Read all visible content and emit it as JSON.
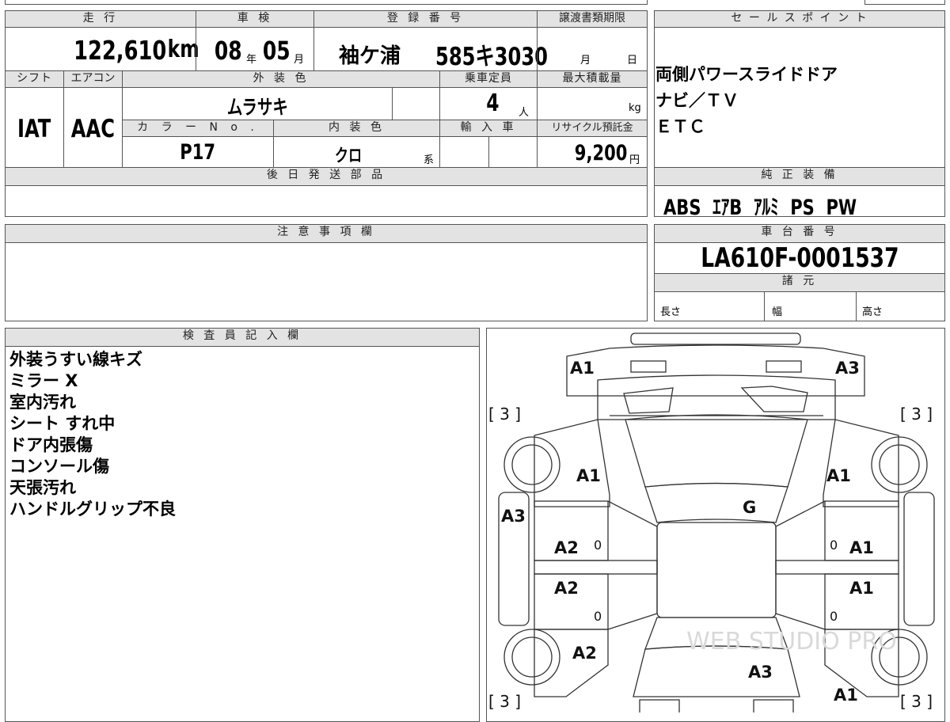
{
  "headers": {
    "mileage": "走 行",
    "inspection": "車 検",
    "plate": "登 録 番 号",
    "transfer_deadline": "譲渡書類期限",
    "sales_point": "セ ー ル ス ポ イ ン ト",
    "shift": "シフト",
    "aircon": "エアコン",
    "exterior_color": "外 装 色",
    "capacity": "乗車定員",
    "max_load": "最大積載量",
    "color_no": "カ ラ ー N o .",
    "interior_color": "内 装 色",
    "import": "輸 入 車",
    "recycle": "リサイクル預託金",
    "later_parts": "後 日 発 送 部 品",
    "genuine_equipment": "純 正 装 備",
    "notes": "注 意 事 項 欄",
    "chassis_no": "車 台 番 号",
    "specs": "諸 元",
    "inspector": "検 査 員 記 入 欄"
  },
  "vehicle": {
    "mileage": "122,610",
    "mileage_unit": "km",
    "inspection_year": "08",
    "year_unit": "年",
    "inspection_month": "05",
    "month_unit": "月",
    "plate_area": "袖ケ浦",
    "plate_number": "585キ3030",
    "deadline_month_unit": "月",
    "deadline_day_unit": "日",
    "shift": "IAT",
    "aircon": "AAC",
    "exterior_color": "ムラサキ",
    "capacity": "4",
    "capacity_unit": "人",
    "max_load_unit": "kg",
    "color_no": "P17",
    "interior_color": "クロ",
    "interior_suffix": "系",
    "recycle_fee": "9,200",
    "recycle_unit": "円",
    "equipment": "ABS  ｴｱB  ｱﾙﾐ  PS  PW",
    "chassis_no": "LA610F-0001537",
    "length_label": "長さ",
    "width_label": "幅",
    "height_label": "高さ"
  },
  "sales_points": [
    "両側パワースライドドア",
    "ナビ／ＴＶ",
    "ＥＴＣ"
  ],
  "inspector_remarks": [
    "外装うすい線キズ",
    "ミラー X",
    "室内汚れ",
    "シート すれ中",
    "ドア内張傷",
    "コンソール傷",
    "天張汚れ",
    "ハンドルグリップ不良"
  ],
  "diagram": {
    "marks": [
      "A1",
      "A3",
      "A1",
      "A1",
      "A3",
      "G",
      "A2",
      "A1",
      "A2",
      "A1",
      "A2",
      "A3",
      "A1"
    ],
    "tire_marks": [
      "[ 3 ]",
      "[ 3 ]",
      "[ 3 ]",
      "[ 3 ]"
    ],
    "zero_marks": [
      "0",
      "0",
      "0",
      "0"
    ],
    "watermark": "WEB STUDIO PRO"
  }
}
